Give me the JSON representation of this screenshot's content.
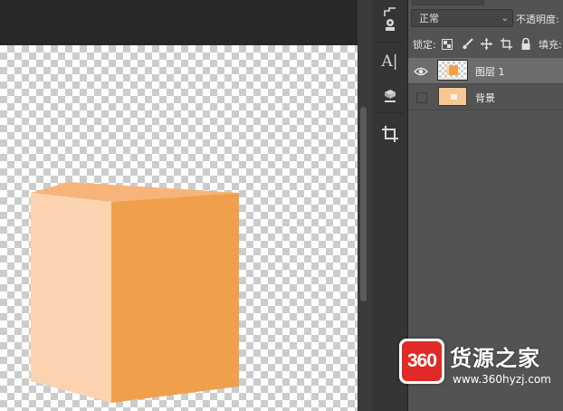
{
  "colors": {
    "cube_front": "#f0a04c",
    "cube_side": "#fbd3b0",
    "cube_top": "#f7b47a",
    "panel_bg": "#535353",
    "selected_layer_bg": "#6d6d6d",
    "watermark_red": "#e02a27"
  },
  "toolstrip": {
    "tools": [
      {
        "icon": "selection-tool-icon"
      },
      {
        "icon": "stamp-icon"
      },
      {
        "icon": "character-paragraph-icon",
        "glyph": "A|"
      },
      {
        "icon": "3d-icon"
      },
      {
        "icon": "crop-icon"
      }
    ]
  },
  "layers_panel": {
    "blend_mode": "正常",
    "opacity_label": "不透明度:",
    "lock_label": "锁定:",
    "fill_label": "填充:",
    "lock_icons": [
      "lock-transparent-icon",
      "lock-paint-icon",
      "lock-move-icon",
      "lock-artboard-icon",
      "lock-all-icon"
    ],
    "layers": [
      {
        "name": "图层 1",
        "visible": true,
        "selected": true
      },
      {
        "name": "背景",
        "visible": false,
        "selected": false
      }
    ]
  },
  "watermark": {
    "badge": "360",
    "title": "货源之家",
    "url": "www.360hyzj.com"
  }
}
